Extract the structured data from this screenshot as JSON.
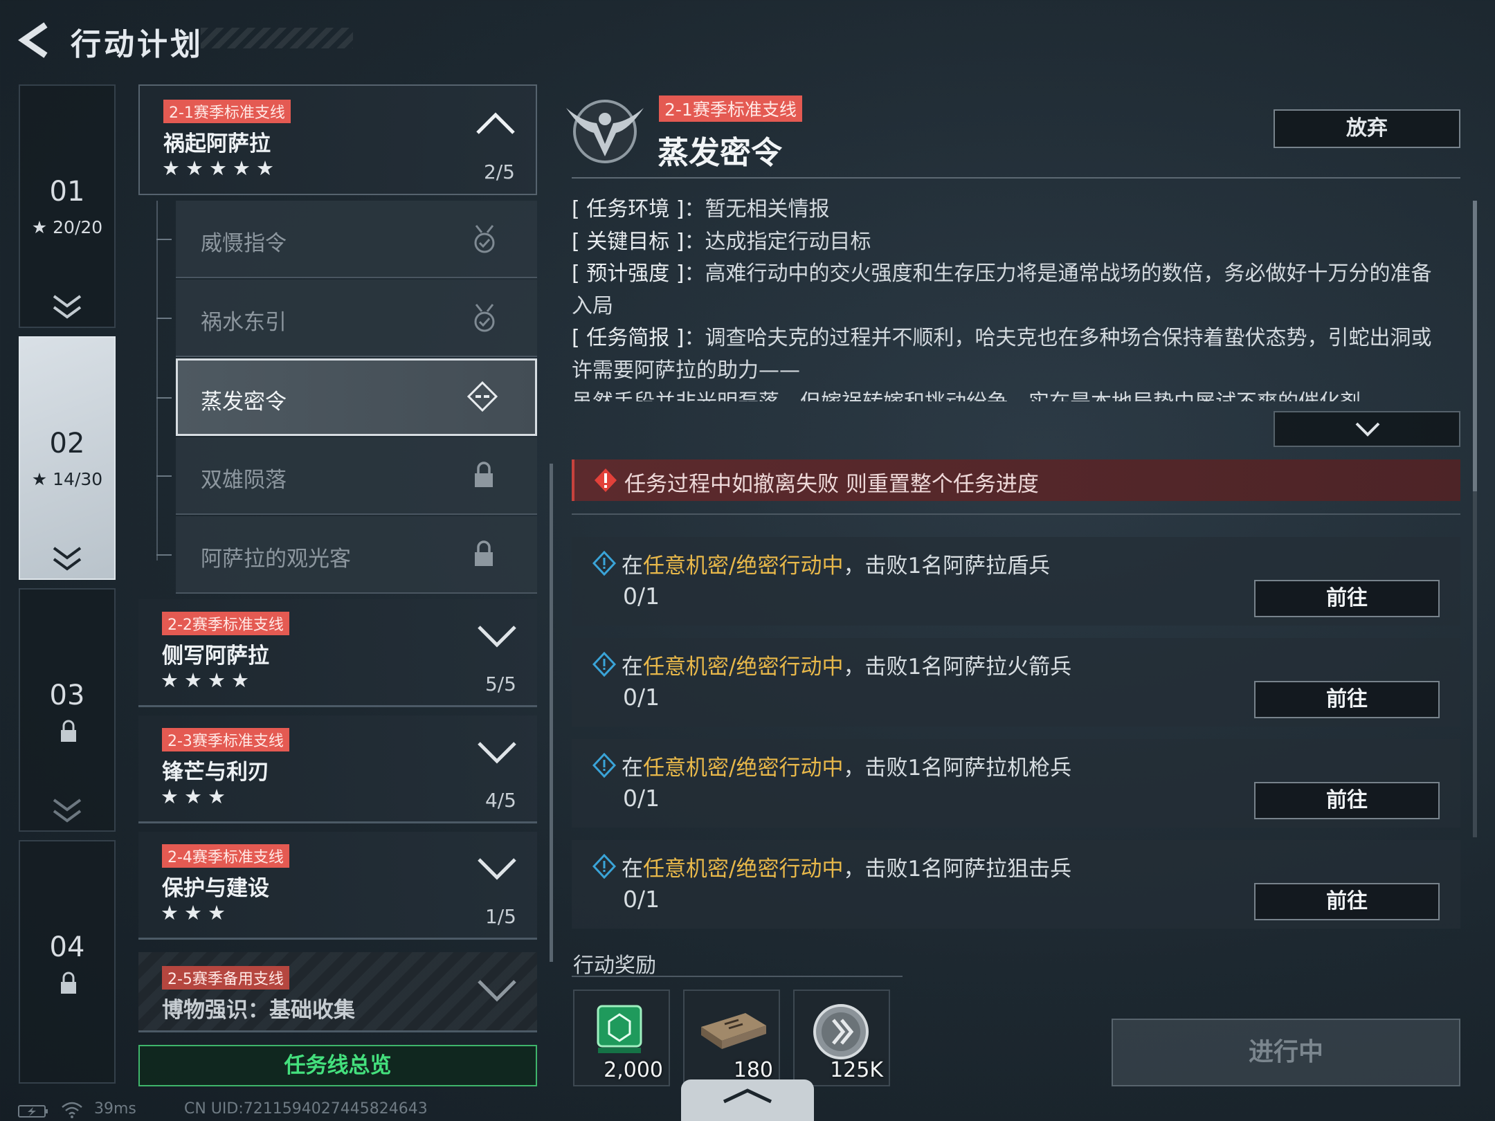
{
  "header": {
    "title": "行动计划"
  },
  "chapters": [
    {
      "num": "01",
      "stars": "20/20"
    },
    {
      "num": "02",
      "stars": "14/30"
    },
    {
      "num": "03"
    },
    {
      "num": "04"
    }
  ],
  "quests": [
    {
      "tag": "2-1赛季标准支线",
      "name": "祸起阿萨拉",
      "stars": "★★★★★",
      "progress": "2/5"
    },
    {
      "tag": "2-2赛季标准支线",
      "name": "侧写阿萨拉",
      "stars": "★★★★",
      "progress": "5/5"
    },
    {
      "tag": "2-3赛季标准支线",
      "name": "锋芒与利刃",
      "stars": "★★★",
      "progress": "4/5"
    },
    {
      "tag": "2-4赛季标准支线",
      "name": "保护与建设",
      "stars": "★★★",
      "progress": "1/5"
    },
    {
      "tag": "2-5赛季备用支线",
      "name": "博物强识：基础收集"
    }
  ],
  "sub_quests": [
    "威慑指令",
    "祸水东引",
    "蒸发密令",
    "双雄陨落",
    "阿萨拉的观光客"
  ],
  "overview_button": "任务线总览",
  "detail": {
    "tag": "2-1赛季标准支线",
    "title": "蒸发密令",
    "abandon": "放弃",
    "info": [
      {
        "key": "[ 任务环境 ]",
        "value": "暂无相关情报"
      },
      {
        "key": "[ 关键目标 ]",
        "value": "达成指定行动目标"
      },
      {
        "key": "[ 预计强度 ]",
        "value": "高难行动中的交火强度和生存压力将是通常战场的数倍，务必做好十万分的准备入局"
      },
      {
        "key": "[ 任务简报 ]",
        "value": "调查哈夫克的过程并不顺利，哈夫克也在多种场合保持着蛰伏态势，引蛇出洞或许需要阿萨拉的助力——"
      }
    ],
    "info_more": "虽然手段并非光明磊落，但嫁祸转嫁和挑动纷争，实在是本地局势中屡试不爽的催化剂……",
    "warning": "任务过程中如撤离失败 则重置整个任务进度",
    "objectives": [
      {
        "prefix": "在",
        "highlight": "任意机密/绝密行动中",
        "suffix": "，击败1名阿萨拉盾兵",
        "progress": "0/1",
        "button": "前往"
      },
      {
        "prefix": "在",
        "highlight": "任意机密/绝密行动中",
        "suffix": "，击败1名阿萨拉火箭兵",
        "progress": "0/1",
        "button": "前往"
      },
      {
        "prefix": "在",
        "highlight": "任意机密/绝密行动中",
        "suffix": "，击败1名阿萨拉机枪兵",
        "progress": "0/1",
        "button": "前往"
      },
      {
        "prefix": "在",
        "highlight": "任意机密/绝密行动中",
        "suffix": "，击败1名阿萨拉狙击兵",
        "progress": "0/1",
        "button": "前往"
      }
    ],
    "rewards_title": "行动奖励",
    "rewards": [
      {
        "icon": "green-ticket-icon",
        "count": "2,000"
      },
      {
        "icon": "bullet-box-icon",
        "count": "180"
      },
      {
        "icon": "silver-coin-icon",
        "count": "125K"
      }
    ],
    "status_button": "进行中"
  },
  "status_bar": {
    "latency": "39ms",
    "uid": "CN UID:7211594027445824643"
  },
  "colors": {
    "tag_red": "#e45a52",
    "highlight_gold": "#e8b84a",
    "overview_green": "#44e07d",
    "warning_bg": "#5c2a2d"
  }
}
